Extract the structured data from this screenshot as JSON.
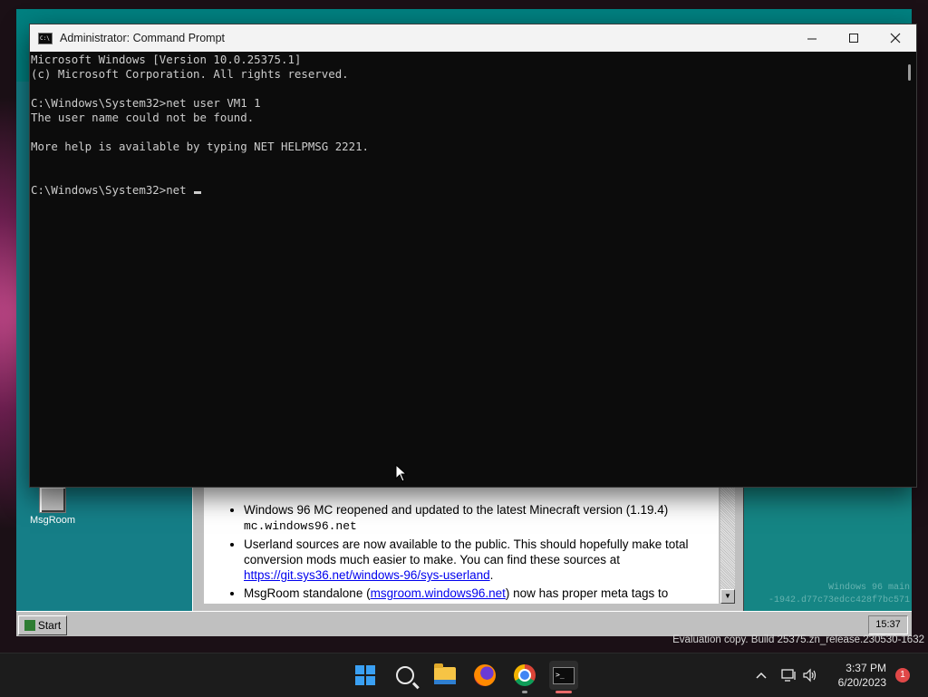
{
  "vm": {
    "icon_label": "MsgRoom",
    "bullets": [
      {
        "text": "Windows 96 MC reopened and updated to the latest Minecraft version (1.19.4)",
        "code": "mc.windows96.net"
      },
      {
        "text": "Userland sources are now available to the public. This should hopefully make total conversion mods much easier to make. You can find these sources at",
        "link": "https://git.sys36.net/windows-96/sys-userland",
        "after": "."
      },
      {
        "before": "MsgRoom standalone (",
        "link": "msgroom.windows96.net",
        "after": ") now has proper meta tags to"
      }
    ],
    "watermark_line1": "Windows 96 main",
    "watermark_line2": "-1942.d77c73edcc428f7bc571",
    "start_label": "Start",
    "clock": "15:37"
  },
  "cmd": {
    "title": "Administrator: Command Prompt",
    "icon_text": "C:\\",
    "lines": [
      "Microsoft Windows [Version 10.0.25375.1]",
      "(c) Microsoft Corporation. All rights reserved.",
      "",
      "C:\\Windows\\System32>net user VM1 1",
      "The user name could not be found.",
      "",
      "More help is available by typing NET HELPMSG 2221.",
      "",
      "",
      "C:\\Windows\\System32>net "
    ]
  },
  "desktop": {
    "evaluation": "Evaluation copy. Build 25375.zn_release.230530-1632"
  },
  "taskbar": {
    "time": "3:37 PM",
    "date": "6/20/2023",
    "notification_count": "1"
  }
}
